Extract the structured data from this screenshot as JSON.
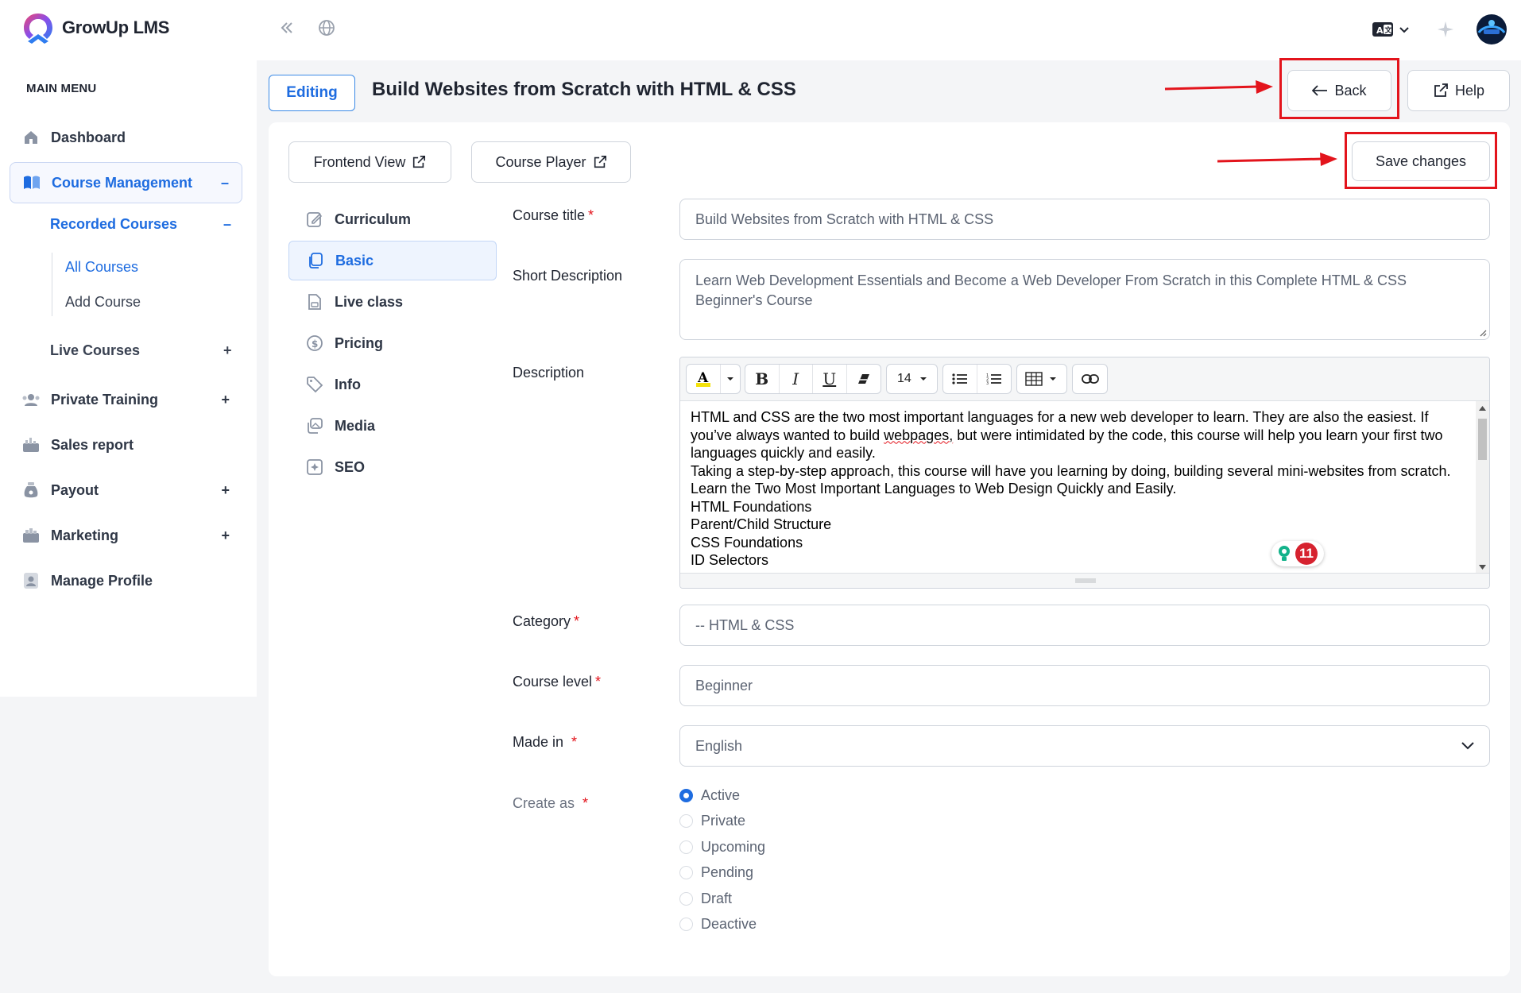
{
  "app": {
    "name": "GrowUp LMS"
  },
  "sidebar": {
    "menu_heading": "MAIN MENU",
    "items": [
      {
        "label": "Dashboard",
        "icon": "home-icon",
        "toggle": ""
      },
      {
        "label": "Course Management",
        "icon": "book-open-icon",
        "toggle": "–"
      },
      {
        "label": "Live Courses",
        "icon": "",
        "toggle": "+"
      },
      {
        "label": "Private Training",
        "icon": "users-icon",
        "toggle": "+"
      },
      {
        "label": "Sales report",
        "icon": "chart-icon",
        "toggle": ""
      },
      {
        "label": "Payout",
        "icon": "money-bag-icon",
        "toggle": "+"
      },
      {
        "label": "Marketing",
        "icon": "marketing-icon",
        "toggle": "+"
      },
      {
        "label": "Manage Profile",
        "icon": "profile-icon",
        "toggle": ""
      }
    ],
    "recorded_courses": {
      "label": "Recorded Courses",
      "toggle": "–"
    },
    "sub_items": [
      "All Courses",
      "Add Course"
    ]
  },
  "header": {
    "editing_badge": "Editing",
    "title": "Build Websites from Scratch with HTML & CSS",
    "back_label": "Back",
    "help_label": "Help",
    "frontend_view_label": "Frontend View",
    "course_player_label": "Course Player",
    "save_label": "Save changes"
  },
  "tabs": [
    "Curriculum",
    "Basic",
    "Live class",
    "Pricing",
    "Info",
    "Media",
    "SEO"
  ],
  "form": {
    "course_title_label": "Course title",
    "course_title_value": "Build Websites from Scratch with HTML & CSS",
    "short_desc_label": "Short Description",
    "short_desc_value": "Learn Web Development Essentials and Become a Web Developer From Scratch in this Complete HTML & CSS Beginner's Course",
    "description_label": "Description",
    "font_size": "14",
    "description_lines": {
      "p1_a": "HTML and CSS are the two most important languages for a new web developer to learn. They are also the easiest. If you’ve always wanted to build ",
      "p1_b": "webpages,",
      "p1_c": " but were intimidated by the code, this course will help you learn your first two languages quickly and easily.",
      "p2": "Taking a step-by-step approach, this course will have you learning by doing, building several mini-websites from scratch.",
      "p3": "Learn the Two Most Important Languages to Web Design Quickly and Easily.",
      "p4": "HTML Foundations",
      "p5": "Parent/Child Structure",
      "p6": "CSS Foundations",
      "p7": "ID Selectors"
    },
    "grammar_badge_count": "11",
    "category_label": "Category",
    "category_value": "-- HTML & CSS",
    "level_label": "Course level",
    "level_value": "Beginner",
    "made_in_label": "Made in",
    "made_in_value": "English",
    "create_as_label": "Create as",
    "create_as_options": [
      "Active",
      "Private",
      "Upcoming",
      "Pending",
      "Draft",
      "Deactive"
    ],
    "create_as_selected": "Active",
    "required_mark": "*"
  },
  "colors": {
    "accent": "#1e6ce0",
    "annotation_red": "#e3141c"
  }
}
